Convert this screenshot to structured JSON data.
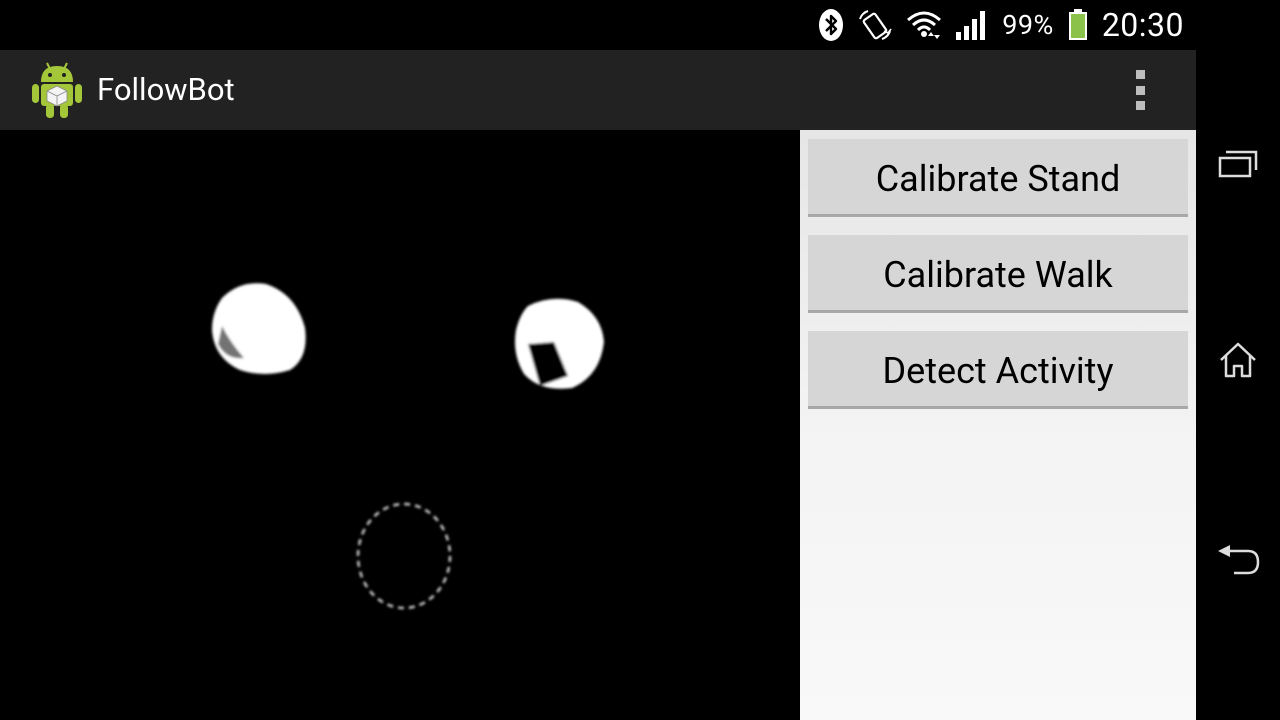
{
  "status_bar": {
    "battery_percent": "99%",
    "time": "20:30",
    "icons": [
      "bluetooth-icon",
      "vibrate-rotate-icon",
      "wifi-icon",
      "signal-icon",
      "battery-icon"
    ]
  },
  "action_bar": {
    "title": "FollowBot",
    "app_icon": "android-robot-icon",
    "menu_icon": "overflow-menu-icon"
  },
  "buttons": {
    "calibrate_stand": "Calibrate Stand",
    "calibrate_walk": "Calibrate Walk",
    "detect_activity": "Detect Activity"
  },
  "nav_bar": {
    "icons": [
      "recent-apps-icon",
      "home-icon",
      "back-icon"
    ]
  },
  "colors": {
    "action_bar_bg": "#222222",
    "button_bg": "#d6d6d6",
    "android_green": "#a4c639",
    "battery_green": "#8bc34a"
  }
}
